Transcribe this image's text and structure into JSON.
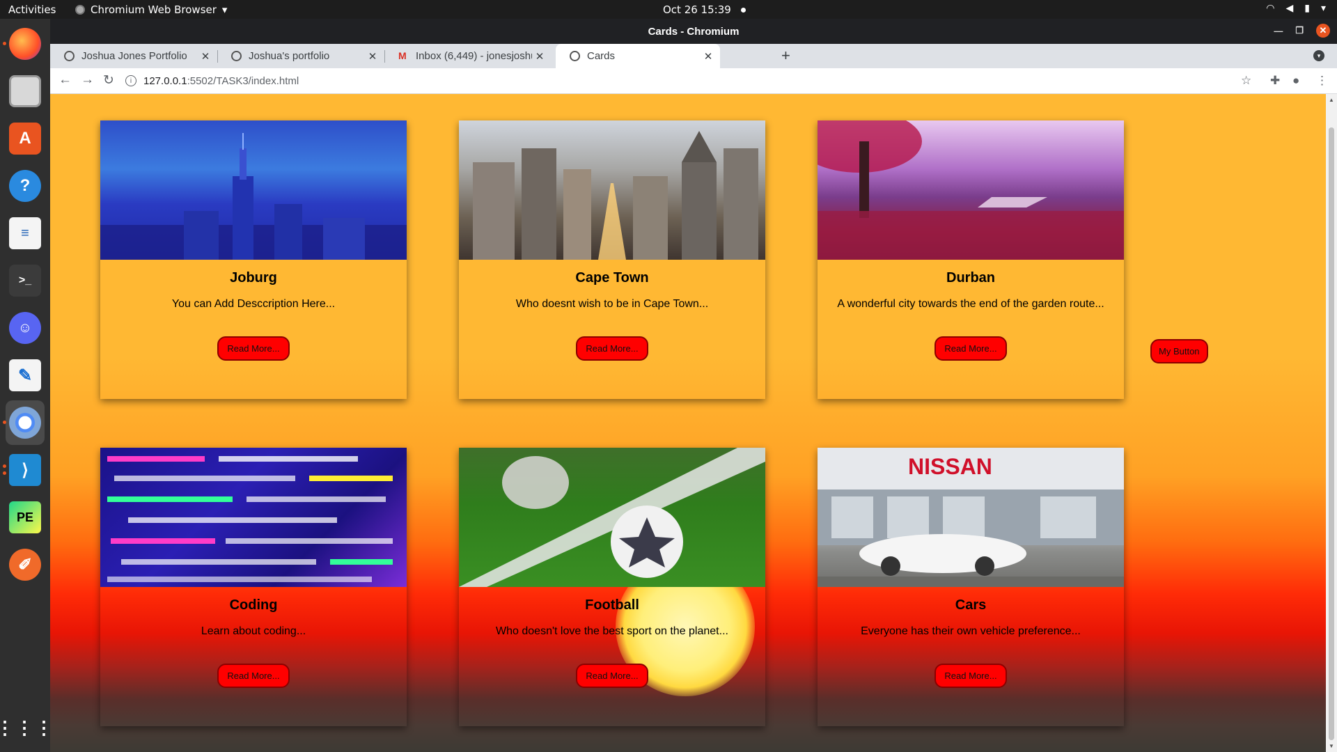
{
  "topbar": {
    "activities": "Activities",
    "app_menu": "Chromium Web Browser",
    "clock": "Oct 26  15:39"
  },
  "window": {
    "title": "Cards - Chromium"
  },
  "tabs": [
    {
      "label": "Joshua Jones Portfolio",
      "favicon": "globe-icon"
    },
    {
      "label": "Joshua's portfolio",
      "favicon": "globe-icon"
    },
    {
      "label": "Inbox (6,449) - jonesjoshu",
      "favicon": "gmail-icon"
    },
    {
      "label": "Cards",
      "favicon": "globe-icon",
      "active": true
    }
  ],
  "address_bar": {
    "host": "127.0.0.1",
    "path": ":5502/TASK3/index.html"
  },
  "cards": [
    {
      "title": "Joburg",
      "description": "You can Add Desccription Here...",
      "button": "Read More...",
      "image": "night city skyline"
    },
    {
      "title": "Cape Town",
      "description": "Who doesnt wish to be in Cape Town...",
      "button": "Read More...",
      "image": "city street at sunrise"
    },
    {
      "title": "Durban",
      "description": "A wonderful city towards the end of the garden route...",
      "button": "Read More...",
      "image": "pink blossom lakeside"
    },
    {
      "title": "Coding",
      "description": "Learn about coding...",
      "button": "Read More...",
      "image": "code on screen"
    },
    {
      "title": "Football",
      "description": "Who doesn't love the best sport on the planet...",
      "button": "Read More...",
      "image": "soccer balls on pitch"
    },
    {
      "title": "Cars",
      "description": "Everyone has their own vehicle preference...",
      "button": "Read More...",
      "image": "Nissan dealership"
    }
  ],
  "cars_sign": "NISSAN",
  "extra_button": "My Button",
  "colors": {
    "button_red": "#ff0000",
    "page_orange": "#ffb833",
    "accent_ubuntu": "#e95420"
  }
}
